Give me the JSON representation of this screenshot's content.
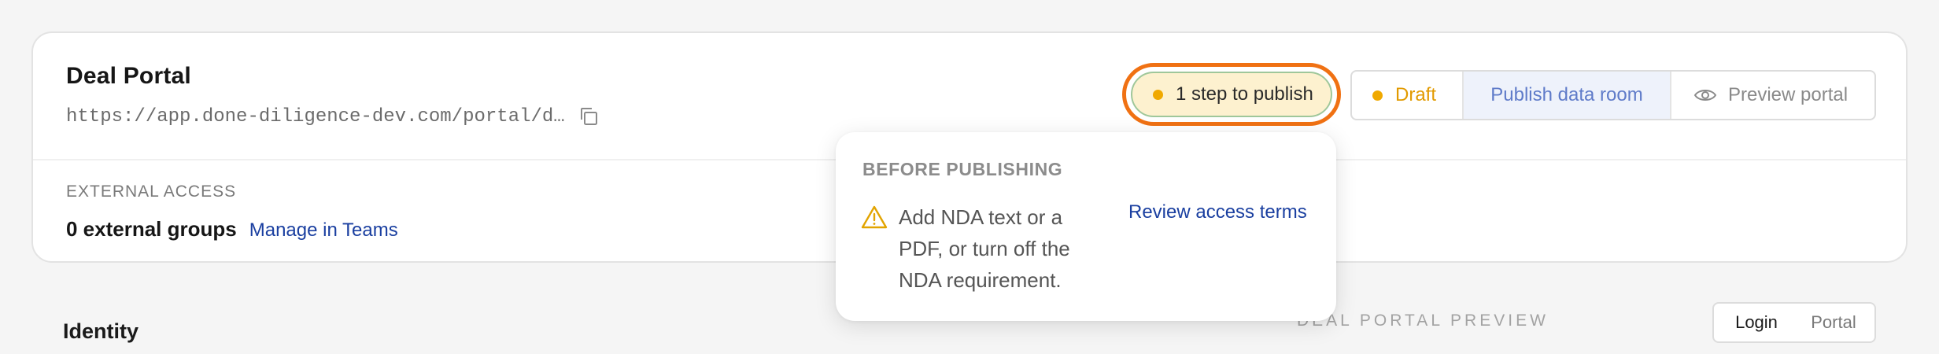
{
  "portal": {
    "title": "Deal Portal",
    "url": "https://app.done-diligence-dev.com/portal/d…"
  },
  "external_access": {
    "label": "EXTERNAL ACCESS",
    "count_text": "0 external groups",
    "manage_link": "Manage in Teams"
  },
  "publish_status": {
    "steps_label": "1 step to publish",
    "draft_label": "Draft",
    "publish_label": "Publish data room",
    "preview_label": "Preview portal"
  },
  "popover": {
    "heading": "BEFORE PUBLISHING",
    "message": "Add NDA text or a PDF, or turn off the NDA requirement.",
    "action_link": "Review access terms"
  },
  "identity": {
    "heading": "Identity"
  },
  "preview_panel": {
    "caption": "DEAL PORTAL PREVIEW",
    "toggle": {
      "options": [
        "Login",
        "Portal"
      ],
      "selected": "Login"
    }
  },
  "icons": {
    "copy": "copy-icon",
    "eye": "eye-icon",
    "warning": "warning-icon",
    "status_dot": "status-dot"
  },
  "colors": {
    "accent_orange": "#f07113",
    "draft_amber": "#e29a00",
    "link_blue": "#1a3fa0",
    "publish_blue": "#5f7bc9",
    "pill_fill": "#fdf1cf"
  }
}
